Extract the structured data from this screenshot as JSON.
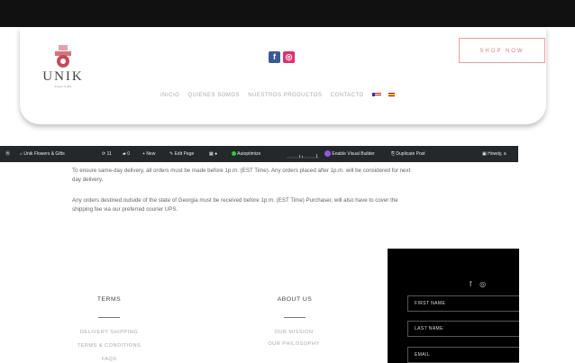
{
  "header": {
    "logo_text": "UNIK",
    "logo_sub": "flowers & gifts",
    "social": [
      "f",
      "◎"
    ],
    "shop_button": "SHOP NOW",
    "nav": [
      "INICIO",
      "QUIENES SOMOS",
      "NUESTROS PRODUCTOS",
      "CONTACTO"
    ]
  },
  "admin_bar": {
    "site": "Unik Flowers & Gifts",
    "updates": "11",
    "comments": "0",
    "new": "New",
    "edit": "Edit Page",
    "autoptimize": "Autoptimize",
    "visual_builder": "Enable Visual Builder",
    "duplicate": "Duplicate Post",
    "howdy": "Howdy, a"
  },
  "policy": {
    "p1": "To ensure same-day delivery, all orders must be made before 1p.m. (EST Time). Any orders placed after 1p.m. will be considered for next day delivery.",
    "p2": "Any orders destined outside of the state of Georgia must be received before 1p.m. (EST Time) Purchaser, will also have to cover the shipping fee via our preferred courier UPS."
  },
  "footer": {
    "terms_title": "TERMS",
    "terms_links": [
      "DELIVERY SHIPPING",
      "TERMS & CONDITIONS",
      "FAQS"
    ],
    "about_title": "ABOUT US",
    "about_links": [
      "OUR MISSION",
      "OUR PHILOSOPHY"
    ]
  },
  "newsletter": {
    "social": [
      "f",
      "◎"
    ],
    "first_name": "FIRST NAME",
    "last_name": "LAST NAME",
    "email": "EMAIL"
  },
  "colors": {
    "accent": "#d98080",
    "admin_bar": "#23282d",
    "newsletter_bg": "#000000"
  }
}
